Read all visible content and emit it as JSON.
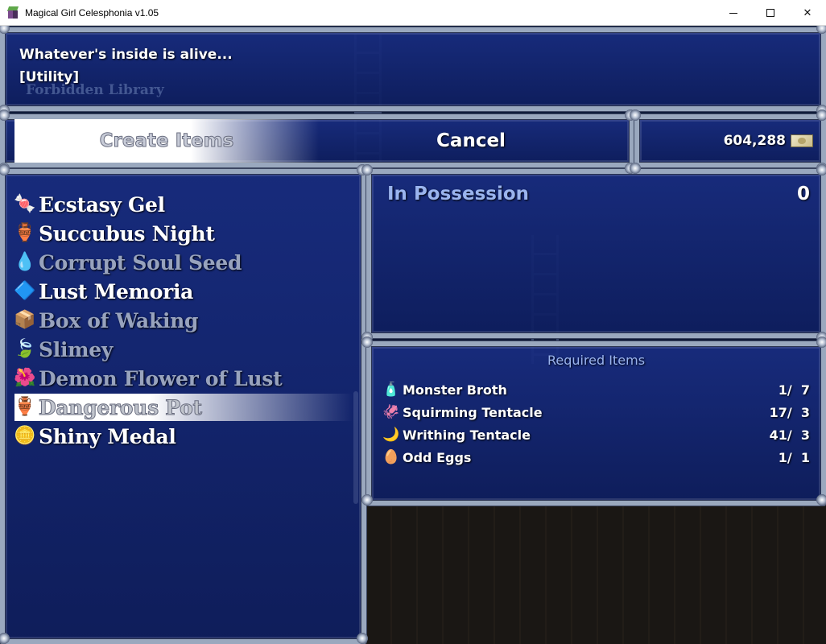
{
  "window": {
    "title": "Magical Girl Celesphonia v1.05",
    "minimize": "—",
    "maximize": "☐",
    "close": "✕"
  },
  "background": {
    "location_caption": "Forbidden Library"
  },
  "help": {
    "line1": "Whatever's inside is alive...",
    "line2": "[Utility]"
  },
  "commands": {
    "create": "Create Items",
    "cancel": "Cancel"
  },
  "gold": {
    "amount": "604,288",
    "icon": "money-icon"
  },
  "items": [
    {
      "label": "Ecstasy Gel",
      "icon": "gel-icon",
      "glyph": "🍬",
      "enabled": true,
      "selected": false
    },
    {
      "label": "Succubus Night",
      "icon": "potion-icon",
      "glyph": "🏺",
      "enabled": true,
      "selected": false
    },
    {
      "label": "Corrupt Soul Seed",
      "icon": "seed-icon",
      "glyph": "💧",
      "enabled": false,
      "selected": false
    },
    {
      "label": "Lust Memoria",
      "icon": "crystal-icon",
      "glyph": "🔷",
      "enabled": true,
      "selected": false
    },
    {
      "label": "Box of Waking",
      "icon": "box-icon",
      "glyph": "📦",
      "enabled": false,
      "selected": false
    },
    {
      "label": "Slimey",
      "icon": "slime-icon",
      "glyph": "🍃",
      "enabled": false,
      "selected": false
    },
    {
      "label": "Demon Flower of Lust",
      "icon": "flower-icon",
      "glyph": "🌺",
      "enabled": false,
      "selected": false
    },
    {
      "label": "Dangerous Pot",
      "icon": "pot-icon",
      "glyph": "🏺",
      "enabled": false,
      "selected": true
    },
    {
      "label": "Shiny Medal",
      "icon": "medal-icon",
      "glyph": "🪙",
      "enabled": true,
      "selected": false
    }
  ],
  "possession": {
    "label": "In Possession",
    "value": "0"
  },
  "required": {
    "header": "Required Items",
    "items": [
      {
        "label": "Monster Broth",
        "icon": "bottle-icon",
        "glyph": "🧴",
        "count": "1/  7"
      },
      {
        "label": "Squirming Tentacle",
        "icon": "tentacle-icon",
        "glyph": "🦑",
        "count": "17/  3"
      },
      {
        "label": "Writhing Tentacle",
        "icon": "hook-tentacle-icon",
        "glyph": "🌙",
        "count": "41/  3"
      },
      {
        "label": "Odd Eggs",
        "icon": "eggs-icon",
        "glyph": "🥚",
        "count": "1/  1"
      }
    ]
  },
  "colors": {
    "window_border": "#9aa8be",
    "window_bg": "#182c80",
    "system_text": "#9ab4ee",
    "disabled_text": "#98a3bd"
  }
}
